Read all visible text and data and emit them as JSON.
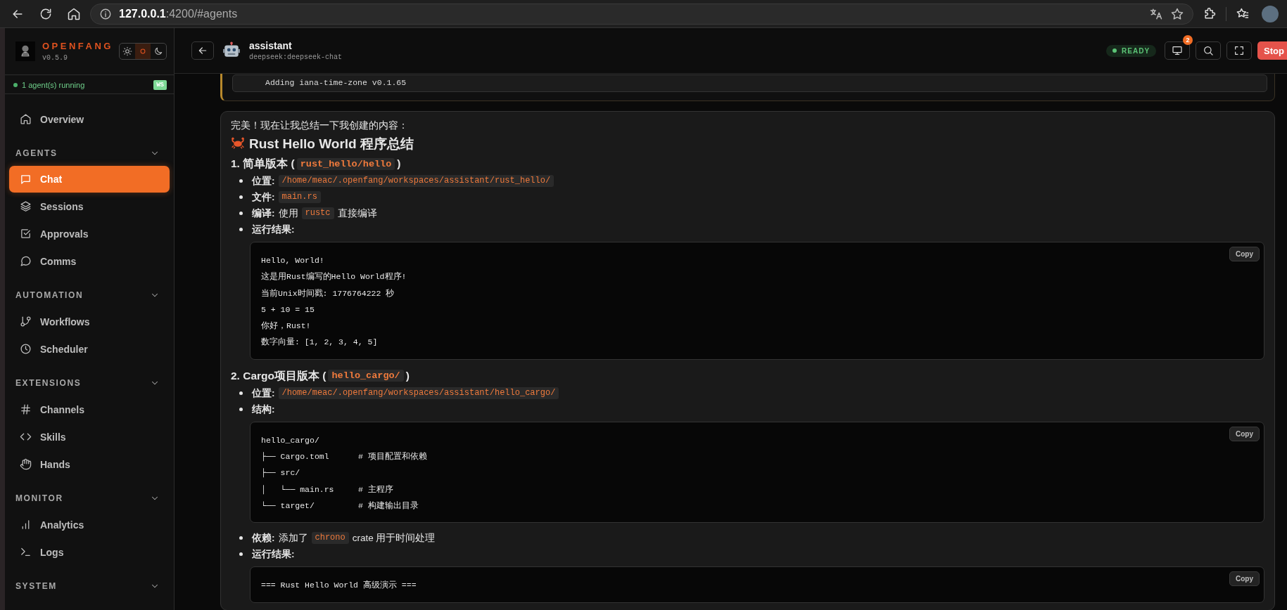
{
  "browser": {
    "url_host": "127.0.0.1",
    "url_path": ":4200/#agents"
  },
  "sidebar": {
    "brand": "OPENFANG",
    "version": "v0.5.9",
    "theme_options": [
      {
        "kind": "light",
        "selected": false
      },
      {
        "kind": "system",
        "selected": true
      },
      {
        "kind": "dark",
        "selected": false
      }
    ],
    "status": {
      "text": "1 agent(s) running",
      "badge": "WS"
    },
    "top_items": [
      {
        "label": "Overview",
        "kind": "home",
        "selected": false
      }
    ],
    "sections": [
      {
        "title": "AGENTS",
        "expanded": true,
        "items": [
          {
            "label": "Chat",
            "kind": "chat",
            "selected": true
          },
          {
            "label": "Sessions",
            "kind": "layers",
            "selected": false
          },
          {
            "label": "Approvals",
            "kind": "checkbox",
            "selected": false
          },
          {
            "label": "Comms",
            "kind": "bubble",
            "selected": false
          }
        ]
      },
      {
        "title": "AUTOMATION",
        "expanded": true,
        "items": [
          {
            "label": "Workflows",
            "kind": "branch",
            "selected": false
          },
          {
            "label": "Scheduler",
            "kind": "clock",
            "selected": false
          }
        ]
      },
      {
        "title": "EXTENSIONS",
        "expanded": true,
        "items": [
          {
            "label": "Channels",
            "kind": "hash",
            "selected": false
          },
          {
            "label": "Skills",
            "kind": "code",
            "selected": false
          },
          {
            "label": "Hands",
            "kind": "hand",
            "selected": false
          }
        ]
      },
      {
        "title": "MONITOR",
        "expanded": true,
        "items": [
          {
            "label": "Analytics",
            "kind": "bars",
            "selected": false
          },
          {
            "label": "Logs",
            "kind": "terminal",
            "selected": false
          }
        ]
      },
      {
        "title": "SYSTEM",
        "expanded": true
      }
    ]
  },
  "header": {
    "agent_name": "assistant",
    "model": "deepseek:deepseek-chat",
    "status": "READY",
    "notification_count": "2",
    "stop_label": "Stop"
  },
  "tool_output": {
    "lines": [
      "Adding iana-time-zone v0.1.65"
    ]
  },
  "message": {
    "blocks": [
      {
        "kind": "paragraph",
        "text": "完美！现在让我总结一下我创建的内容："
      },
      {
        "kind": "heading",
        "text": "Rust Hello World 程序总结"
      },
      {
        "kind": "subheading",
        "segments": [
          {
            "kind": "text",
            "text": "1. 简单版本 ("
          },
          {
            "kind": "code",
            "text": "rust_hello/hello"
          },
          {
            "kind": "text",
            "text": ")"
          }
        ]
      },
      {
        "kind": "list",
        "items": [
          {
            "label": "位置:",
            "segments": [
              {
                "kind": "code",
                "text": "/home/meac/.openfang/workspaces/assistant/rust_hello/"
              }
            ]
          },
          {
            "label": "文件:",
            "segments": [
              {
                "kind": "code",
                "text": "main.rs"
              }
            ]
          },
          {
            "label": "编译:",
            "segments": [
              {
                "kind": "text",
                "text": "使用"
              },
              {
                "kind": "code",
                "text": "rustc"
              },
              {
                "kind": "text",
                "text": "直接编译"
              }
            ]
          },
          {
            "label": "运行结果:",
            "code_block": {
              "copy_label": "Copy",
              "lines": [
                "Hello, World!",
                "这是用Rust编写的Hello World程序!",
                "当前Unix时间戳: 1776764222 秒",
                "5 + 10 = 15",
                "你好，Rust!",
                "数字向量: [1, 2, 3, 4, 5]"
              ]
            }
          }
        ]
      },
      {
        "kind": "subheading",
        "segments": [
          {
            "kind": "text",
            "text": "2. Cargo项目版本 ("
          },
          {
            "kind": "code",
            "text": "hello_cargo/"
          },
          {
            "kind": "text",
            "text": ")"
          }
        ]
      },
      {
        "kind": "list",
        "items": [
          {
            "label": "位置:",
            "segments": [
              {
                "kind": "code",
                "text": "/home/meac/.openfang/workspaces/assistant/hello_cargo/"
              }
            ]
          },
          {
            "label": "结构:",
            "code_block": {
              "copy_label": "Copy",
              "lines": [
                "hello_cargo/",
                "├── Cargo.toml      # 项目配置和依赖",
                "├── src/",
                "│   └── main.rs     # 主程序",
                "└── target/         # 构建输出目录"
              ]
            }
          },
          {
            "label": "依赖:",
            "segments": [
              {
                "kind": "text",
                "text": "添加了"
              },
              {
                "kind": "code",
                "text": "chrono"
              },
              {
                "kind": "text",
                "text": "crate 用于时间处理"
              }
            ]
          },
          {
            "label": "运行结果:",
            "code_block": {
              "copy_label": "Copy",
              "lines": [
                "=== Rust Hello World 高级演示 ==="
              ]
            }
          }
        ]
      }
    ]
  }
}
